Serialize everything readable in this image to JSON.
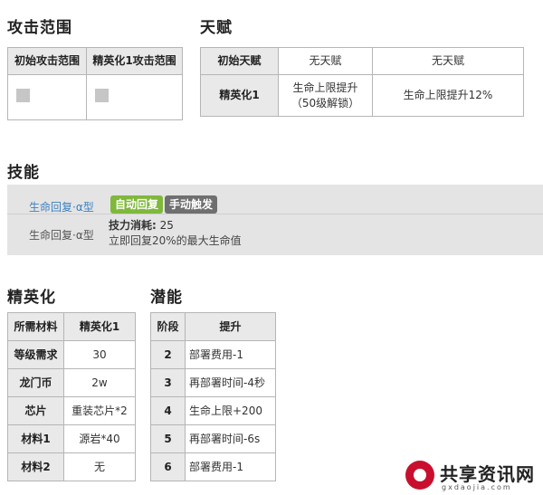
{
  "attack_range": {
    "heading": "攻击范围",
    "headers": [
      "初始攻击范围",
      "精英化1攻击范围"
    ]
  },
  "talent": {
    "heading": "天赋",
    "rows": [
      [
        "初始天赋",
        "无天赋",
        "无天赋"
      ],
      [
        "精英化1",
        "生命上限提升\n（50级解锁）",
        "生命上限提升12%"
      ]
    ]
  },
  "skills": {
    "heading": "技能",
    "skill_link": "生命回复·α型",
    "skill_name": "生命回复·α型",
    "tag_auto": "自动回复",
    "tag_manual": "手动触发",
    "cost_label": "技力消耗:",
    "cost_value": "25",
    "description": "立即回复20%的最大生命值",
    "colors": {
      "link": "#3b82c4",
      "auto": "#7fb83a",
      "manual": "#6f6f6f"
    }
  },
  "elite": {
    "heading": "精英化",
    "headers": [
      "所需材料",
      "精英化1"
    ],
    "rows": [
      [
        "等级需求",
        "30"
      ],
      [
        "龙门币",
        "2w"
      ],
      [
        "芯片",
        "重装芯片*2"
      ],
      [
        "材料1",
        "源岩*40"
      ],
      [
        "材料2",
        "无"
      ]
    ]
  },
  "potential": {
    "heading": "潜能",
    "headers": [
      "阶段",
      "提升"
    ],
    "rows": [
      [
        "2",
        "部署费用-1"
      ],
      [
        "3",
        "再部署时间-4秒"
      ],
      [
        "4",
        "生命上限+200"
      ],
      [
        "5",
        "再部署时间-6s"
      ],
      [
        "6",
        "部署费用-1"
      ]
    ]
  },
  "watermark": {
    "brand": "共享资讯网",
    "url": "gxdaojia.com"
  }
}
